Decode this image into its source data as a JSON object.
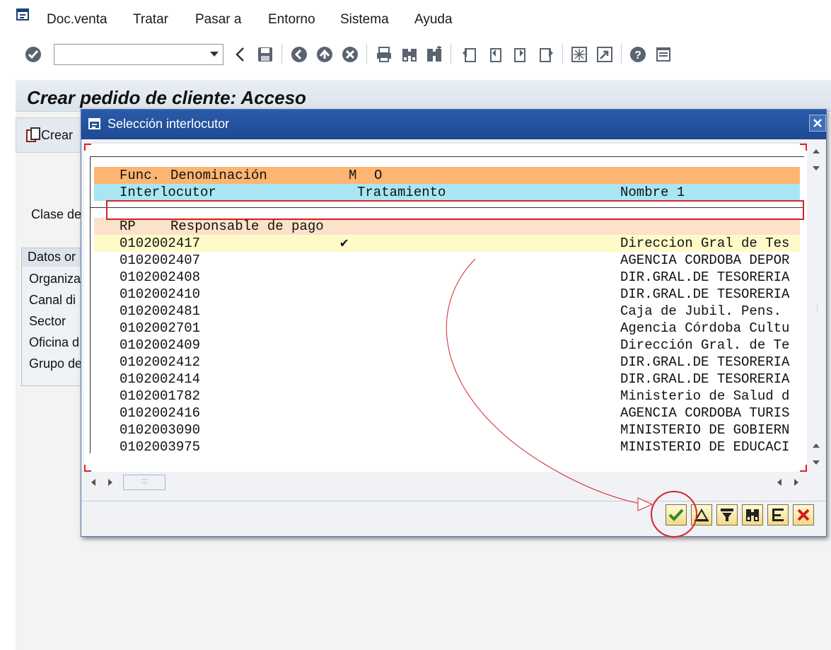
{
  "menubar": {
    "items": [
      "Doc.venta",
      "Tratar",
      "Pasar a",
      "Entorno",
      "Sistema",
      "Ayuda"
    ]
  },
  "toolbar": {
    "command_value": "",
    "icons": [
      "enter-icon",
      "back-arrow-icon",
      "save-icon",
      "back-icon",
      "exit-icon",
      "cancel-icon",
      "print-icon",
      "find-icon",
      "find-next-icon",
      "first-page-icon",
      "previous-page-icon",
      "next-page-icon",
      "last-page-icon",
      "new-session-icon",
      "shortcut-icon",
      "help-icon",
      "layout-icon"
    ]
  },
  "background_screen": {
    "title": "Crear pedido de cliente: Acceso",
    "create_button": "Crear",
    "clase_label": "Clase de",
    "group_header": "Datos or",
    "fields": [
      "Organiza",
      "Canal di",
      "Sector",
      "Oficina d",
      "Grupo de"
    ]
  },
  "dialog": {
    "title": "Selección interlocutor",
    "header_row_1": {
      "func": "Func.",
      "denominacion": "Denominación",
      "m": "M",
      "o": "O"
    },
    "header_row_2": {
      "interlocutor": "Interlocutor",
      "tratamiento": "Tratamiento",
      "nombre": "Nombre 1"
    },
    "group": {
      "code": "RP",
      "name": "Responsable de pago"
    },
    "rows": [
      {
        "id": "0102002417",
        "check": "✔",
        "name": "Direccion Gral de Tes",
        "selected": true
      },
      {
        "id": "0102002407",
        "check": "",
        "name": "AGENCIA CORDOBA DEPOR"
      },
      {
        "id": "0102002408",
        "check": "",
        "name": "DIR.GRAL.DE TESORERIA"
      },
      {
        "id": "0102002410",
        "check": "",
        "name": "DIR.GRAL.DE TESORERIA"
      },
      {
        "id": "0102002481",
        "check": "",
        "name": "Caja de Jubil. Pens."
      },
      {
        "id": "0102002701",
        "check": "",
        "name": "Agencia Córdoba Cultu"
      },
      {
        "id": "0102002409",
        "check": "",
        "name": "Dirección Gral. de Te"
      },
      {
        "id": "0102002412",
        "check": "",
        "name": "DIR.GRAL.DE TESORERIA"
      },
      {
        "id": "0102002414",
        "check": "",
        "name": "DIR.GRAL.DE TESORERIA"
      },
      {
        "id": "0102001782",
        "check": "",
        "name": "Ministerio de Salud d"
      },
      {
        "id": "0102002416",
        "check": "",
        "name": "AGENCIA CORDOBA TURIS"
      },
      {
        "id": "0102003090",
        "check": "",
        "name": "MINISTERIO DE GOBIERN"
      },
      {
        "id": "0102003975",
        "check": "",
        "name": "MINISTERIO DE EDUCACI"
      }
    ],
    "hscroll_thumb": ":::",
    "footer_buttons": [
      "confirm-icon",
      "select-all-icon",
      "filter-icon",
      "find-icon",
      "details-icon",
      "cancel-icon"
    ]
  },
  "colors": {
    "header_orange": "#fdb571",
    "header_cyan": "#a8e6f3",
    "group_row": "#fbe2c9",
    "selected_row": "#fffbc8",
    "dialog_titlebar": "#2a5aa8",
    "annotation_red": "#d4242c"
  }
}
